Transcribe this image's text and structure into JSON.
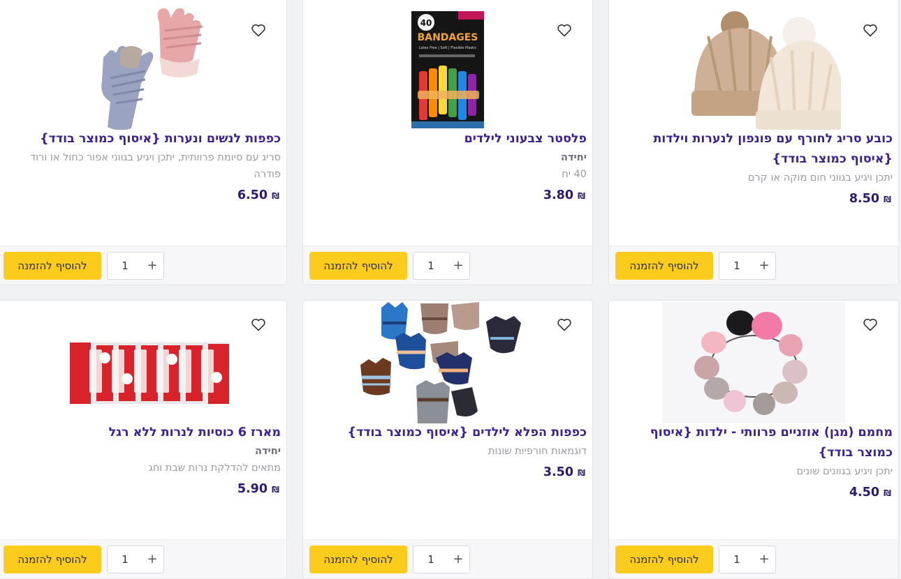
{
  "colors": {
    "accent": "#fccc1d",
    "title": "#3d2193",
    "price": "#2d1a70"
  },
  "icons": {
    "wishlist": "heart-icon",
    "increment": "plus-icon"
  },
  "products": [
    {
      "title": "כפפות לנשים ונערות {איסוף כמוצר בודד}",
      "unit": "",
      "desc": "סריג עם סיומת פרוותית, יתכן ויגיע בגווני אפור כחול או ורוד פודרה",
      "price": "6.50",
      "currency": "₪",
      "qty": "1",
      "qty_plus": "+",
      "button": "להוסיף להזמנה"
    },
    {
      "title": "פלסטר צבעוני לילדים",
      "unit": "יחידה",
      "desc": "40 יח",
      "price": "3.80",
      "currency": "₪",
      "qty": "1",
      "qty_plus": "+",
      "button": "להוסיף להזמנה"
    },
    {
      "title": "כובע סריג לחורף עם פונפון לנערות וילדות {איסוף כמוצר בודד}",
      "unit": "",
      "desc": "יתכן ויגיע בגווני חום מוקה או קרם",
      "price": "8.50",
      "currency": "₪",
      "qty": "1",
      "qty_plus": "+",
      "button": "להוסיף להזמנה"
    },
    {
      "title": "מארז 6 כוסיות לנרות ללא רגל",
      "unit": "יחידה",
      "desc": "מתאים להדלקת נרות שבת וחג",
      "price": "5.90",
      "currency": "₪",
      "qty": "1",
      "qty_plus": "+",
      "button": "להוסיף להזמנה"
    },
    {
      "title": "כפפות הפלא לילדים {איסוף כמוצר בודד}",
      "unit": "",
      "desc": "דוגמאות חורפיות שונות",
      "price": "3.50",
      "currency": "₪",
      "qty": "1",
      "qty_plus": "+",
      "button": "להוסיף להזמנה"
    },
    {
      "title": "מחמם (מגן) אוזניים פרוותי - ילדות {איסוף כמוצר בודד}",
      "unit": "",
      "desc": "יתכן ויגיע בגוונים שונים",
      "price": "4.50",
      "currency": "₪",
      "qty": "1",
      "qty_plus": "+",
      "button": "להוסיף להזמנה"
    }
  ],
  "image_text": {
    "bandages_badge": "40",
    "bandages_brand": "BANDAGES",
    "bandages_sub": "Latex Free | Soft | Flexible Plastic"
  }
}
